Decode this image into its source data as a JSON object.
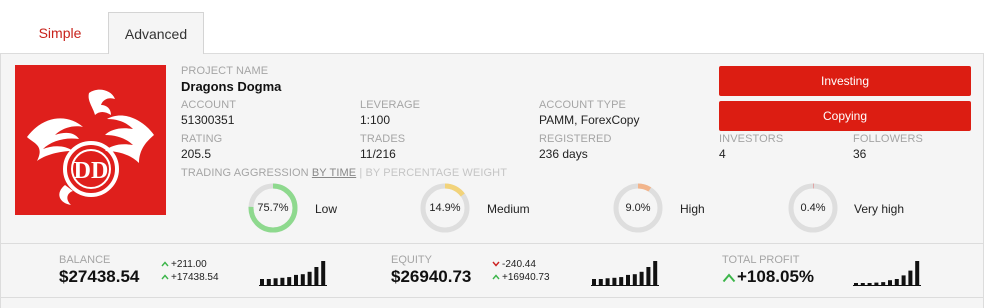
{
  "tabs": [
    {
      "label": "Simple",
      "active": false
    },
    {
      "label": "Advanced",
      "active": true
    }
  ],
  "colors": {
    "accent": "#dc1d12",
    "low": "#8ed98e",
    "medium": "#f2d37a",
    "high": "#f2b58c",
    "very_high": "#e07f7f",
    "ring_track": "#dedede",
    "up": "#3cb54a",
    "down": "#cc2222"
  },
  "logo": {
    "icon": "dragon-logo-icon",
    "monogram": "DD"
  },
  "project": {
    "name_label": "PROJECT NAME",
    "name": "Dragons Dogma"
  },
  "account": {
    "label": "ACCOUNT",
    "value": "51300351"
  },
  "leverage": {
    "label": "LEVERAGE",
    "value": "1:100"
  },
  "account_type": {
    "label": "ACCOUNT TYPE",
    "value": "PAMM, ForexCopy"
  },
  "rating": {
    "label": "RATING",
    "value": "205.5"
  },
  "trades": {
    "label": "TRADES",
    "value": "11/216"
  },
  "registered": {
    "label": "REGISTERED",
    "value": "236 days"
  },
  "investors": {
    "label": "INVESTORS",
    "value": "4"
  },
  "followers": {
    "label": "FOLLOWERS",
    "value": "36"
  },
  "buttons": {
    "investing": "Investing",
    "copying": "Copying"
  },
  "aggression": {
    "label": "TRADING AGGRESSION",
    "by_time": "BY TIME",
    "divider": "|",
    "by_percentage": "BY PERCENTAGE WEIGHT",
    "items": [
      {
        "pct": "75.7%",
        "fraction": 0.757,
        "label": "Low",
        "color": "#8ed98e"
      },
      {
        "pct": "14.9%",
        "fraction": 0.149,
        "label": "Medium",
        "color": "#f2d37a"
      },
      {
        "pct": "9.0%",
        "fraction": 0.09,
        "label": "High",
        "color": "#f2b58c"
      },
      {
        "pct": "0.4%",
        "fraction": 0.004,
        "label": "Very high",
        "color": "#e07f7f"
      }
    ]
  },
  "balance": {
    "label": "BALANCE",
    "value": "$27438.54",
    "change_1": "+211.00",
    "change_1_dir": "up",
    "change_2": "+17438.54",
    "change_2_dir": "up",
    "bars": [
      0.25,
      0.25,
      0.28,
      0.3,
      0.33,
      0.42,
      0.45,
      0.55,
      0.75,
      1.0
    ]
  },
  "equity": {
    "label": "EQUITY",
    "value": "$26940.73",
    "change_1": "-240.44",
    "change_1_dir": "down",
    "change_2": "+16940.73",
    "change_2_dir": "up",
    "bars": [
      0.25,
      0.25,
      0.28,
      0.3,
      0.33,
      0.42,
      0.45,
      0.55,
      0.75,
      1.0
    ]
  },
  "total_profit": {
    "label": "TOTAL PROFIT",
    "value": "+108.05%",
    "dir": "up",
    "bars": [
      0.05,
      0.05,
      0.08,
      0.1,
      0.12,
      0.2,
      0.25,
      0.4,
      0.6,
      1.0
    ]
  }
}
